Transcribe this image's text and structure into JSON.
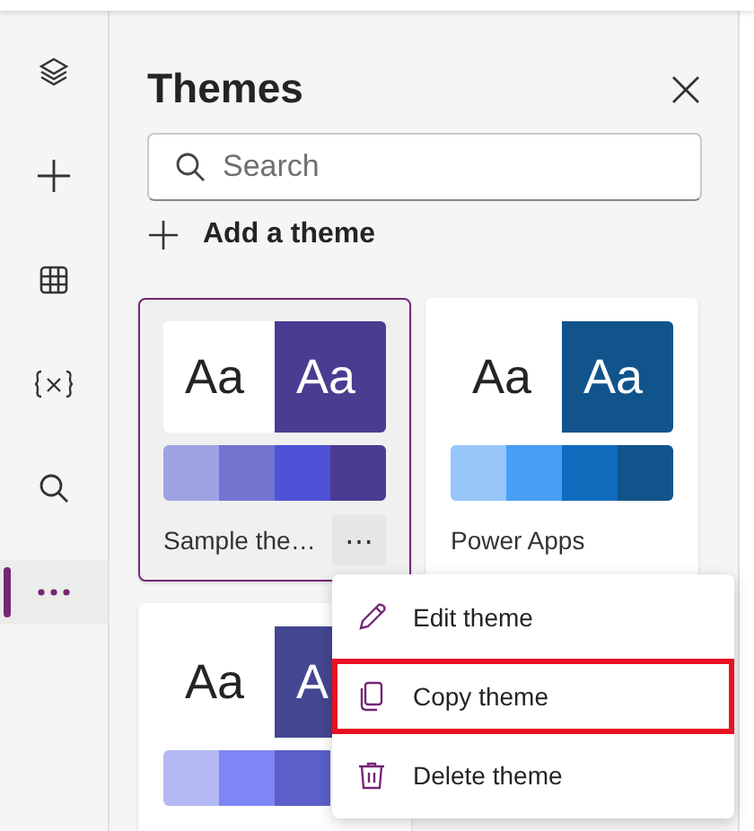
{
  "rail": [
    {
      "kind": "layers",
      "selected": false
    },
    {
      "kind": "plus",
      "selected": false
    },
    {
      "kind": "table",
      "selected": false
    },
    {
      "kind": "variable",
      "selected": false
    },
    {
      "kind": "search",
      "selected": false
    },
    {
      "kind": "more",
      "selected": true
    }
  ],
  "panel": {
    "title": "Themes",
    "search": {
      "placeholder": "Search"
    },
    "add_label": "Add a theme"
  },
  "themes": [
    {
      "name": "Sample the…",
      "selected": true,
      "more": "⋯",
      "samples": [
        {
          "text": "Aa",
          "color": "#ffffff"
        },
        {
          "text": "Aa",
          "color": "#483d91"
        }
      ],
      "swatches": [
        {
          "color": "#9ea3e3"
        },
        {
          "color": "#7274cf"
        },
        {
          "color": "#4f52d6"
        },
        {
          "color": "#483d91"
        }
      ]
    },
    {
      "name": "Power Apps",
      "selected": false,
      "samples": [
        {
          "text": "Aa",
          "color": "#ffffff"
        },
        {
          "text": "Aa",
          "color": "#11548c"
        }
      ],
      "swatches": [
        {
          "color": "#98c6f9"
        },
        {
          "color": "#479ef5"
        },
        {
          "color": "#0f6cbd"
        },
        {
          "color": "#11548c"
        }
      ]
    },
    {
      "selected": false,
      "samples": [
        {
          "text": "Aa",
          "color": "#ffffff"
        },
        {
          "text": "A",
          "color": "#444791"
        }
      ],
      "swatches": [
        {
          "color": "#b4b9f5"
        },
        {
          "color": "#7f85f5"
        },
        {
          "color": "#5b5fc7"
        }
      ]
    }
  ],
  "menu": [
    {
      "kind": "edit",
      "label": "Edit theme",
      "highlighted": false
    },
    {
      "kind": "copy",
      "label": "Copy theme",
      "highlighted": true
    },
    {
      "kind": "delete",
      "label": "Delete theme",
      "highlighted": false
    }
  ]
}
